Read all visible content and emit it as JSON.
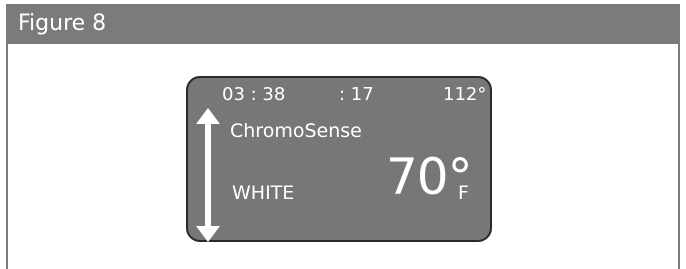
{
  "figure": {
    "title": "Figure 8"
  },
  "display": {
    "time": "03 : 38",
    "seconds": ": 17",
    "angle": "112°",
    "mode": "ChromoSense",
    "color": "WHITE",
    "temperature": "70°",
    "unit": "F",
    "icons": [
      "up-down-arrow-icon"
    ]
  }
}
